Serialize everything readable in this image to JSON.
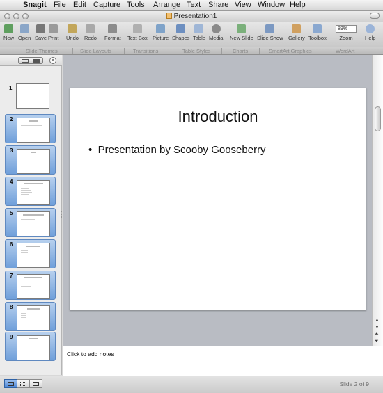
{
  "menubar": {
    "app_name": "Snagit",
    "items": [
      "File",
      "Edit",
      "Capture",
      "Tools",
      "Arrange",
      "Text",
      "Share",
      "View",
      "Window",
      "Help"
    ]
  },
  "window": {
    "title": "Presentation1"
  },
  "toolbar": {
    "buttons": [
      {
        "label": "New",
        "icon": "new-icon"
      },
      {
        "label": "Open",
        "icon": "open-icon"
      },
      {
        "label": "Save",
        "icon": "save-icon"
      },
      {
        "label": "Print",
        "icon": "print-icon"
      },
      {
        "label": "Undo",
        "icon": "undo-icon"
      },
      {
        "label": "Redo",
        "icon": "redo-icon"
      },
      {
        "label": "Format",
        "icon": "format-icon"
      },
      {
        "label": "Text Box",
        "icon": "textbox-icon"
      },
      {
        "label": "Picture",
        "icon": "picture-icon"
      },
      {
        "label": "Shapes",
        "icon": "shapes-icon"
      },
      {
        "label": "Table",
        "icon": "table-icon"
      },
      {
        "label": "Media",
        "icon": "media-icon"
      },
      {
        "label": "New Slide",
        "icon": "new-slide-icon"
      },
      {
        "label": "Slide Show",
        "icon": "slideshow-icon"
      },
      {
        "label": "Gallery",
        "icon": "gallery-icon"
      },
      {
        "label": "Toolbox",
        "icon": "toolbox-icon"
      },
      {
        "label": "Zoom",
        "icon": "zoom-icon"
      },
      {
        "label": "Help",
        "icon": "help-icon"
      }
    ],
    "zoom_value": "89%"
  },
  "ribbon": {
    "tabs": [
      "Slide Themes",
      "Slide Layouts",
      "Transitions",
      "Table Styles",
      "Charts",
      "SmartArt Graphics",
      "WordArt"
    ]
  },
  "slides": [
    {
      "num": "1",
      "selected": false
    },
    {
      "num": "2",
      "selected": true,
      "thumb_title": "Introduction"
    },
    {
      "num": "3",
      "selected": true,
      "thumb_title": "Purpose"
    },
    {
      "num": "4",
      "selected": true,
      "thumb_title": "Advantages of Product"
    },
    {
      "num": "5",
      "selected": true,
      "thumb_title": "Company Overview"
    },
    {
      "num": "6",
      "selected": true,
      "thumb_title": "Specifications"
    },
    {
      "num": "7",
      "selected": true,
      "thumb_title": "Product Comparison"
    },
    {
      "num": "8",
      "selected": true,
      "thumb_title": "Conclusion"
    },
    {
      "num": "9",
      "selected": true,
      "thumb_title": "Thank You"
    }
  ],
  "current_slide": {
    "title": "Introduction",
    "bullet": "Presentation by Scooby Gooseberry"
  },
  "notes": {
    "placeholder": "Click to add notes"
  },
  "status": {
    "slide_info": "Slide 2 of 9"
  },
  "colors": {
    "selection_blue": "#6f9fda",
    "workspace_bg": "#b9bcc3"
  }
}
